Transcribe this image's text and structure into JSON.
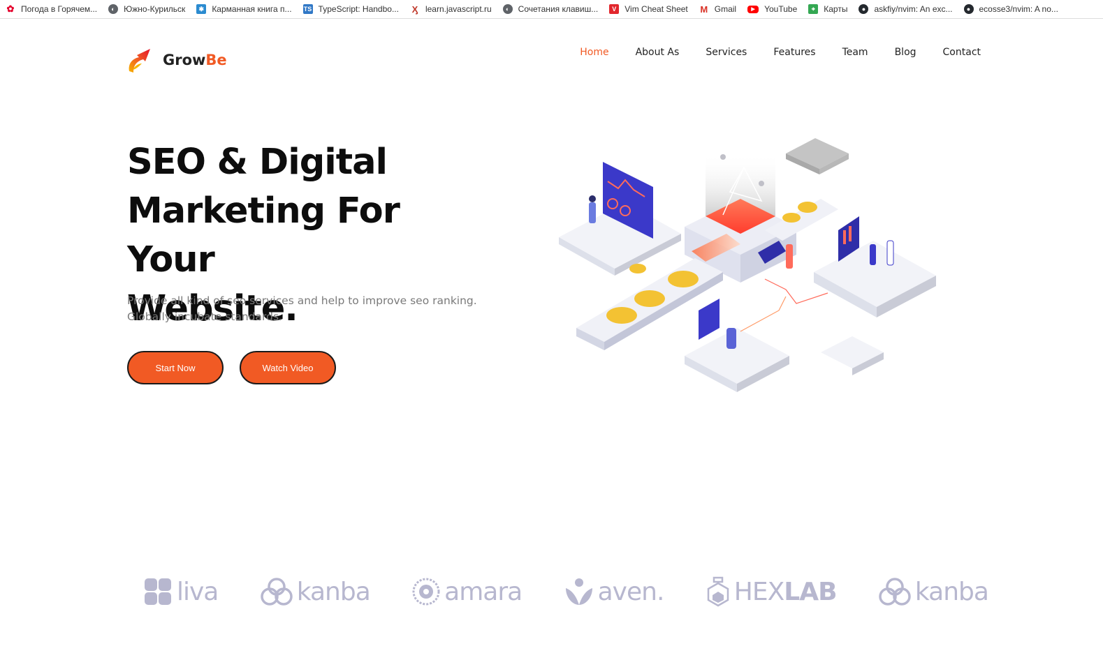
{
  "bookmarks": [
    {
      "label": "Погода в Горячем...",
      "icon": "huawei-icon",
      "color": "#e4002b"
    },
    {
      "label": "Южно-Курильск",
      "icon": "globe-icon",
      "color": "#5f6368"
    },
    {
      "label": "Карманная книга п...",
      "icon": "gear-icon",
      "color": "#2b8bd0"
    },
    {
      "label": "TypeScript: Handbo...",
      "icon": "typescript-icon",
      "color": "#3178c6"
    },
    {
      "label": "learn.javascript.ru",
      "icon": "figure-icon",
      "color": "#c0392b"
    },
    {
      "label": "Сочетания клавиш...",
      "icon": "globe-icon",
      "color": "#5f6368"
    },
    {
      "label": "Vim Cheat Sheet",
      "icon": "vim-icon",
      "color": "#e2272d"
    },
    {
      "label": "Gmail",
      "icon": "gmail-icon",
      "color": "#d93025"
    },
    {
      "label": "YouTube",
      "icon": "youtube-icon",
      "color": "#ff0000"
    },
    {
      "label": "Карты",
      "icon": "maps-icon",
      "color": "#34a853"
    },
    {
      "label": "askfiy/nvim: An exc...",
      "icon": "github-icon",
      "color": "#24292e"
    },
    {
      "label": "ecosse3/nvim: A no...",
      "icon": "github-icon",
      "color": "#24292e"
    }
  ],
  "brand": {
    "name_main": "Grow",
    "name_accent": "Be",
    "accent_color": "#f15a24"
  },
  "nav": [
    {
      "label": "Home",
      "active": true
    },
    {
      "label": "About As",
      "active": false
    },
    {
      "label": "Services",
      "active": false
    },
    {
      "label": "Features",
      "active": false
    },
    {
      "label": "Team",
      "active": false
    },
    {
      "label": "Blog",
      "active": false
    },
    {
      "label": "Contact",
      "active": false
    }
  ],
  "hero": {
    "title_line1": "SEO & Digital",
    "title_line2": "Marketing For Your",
    "title_line3": "Website.",
    "subtitle_line1": "Provide all kind of seo services and help to improve seo ranking.",
    "subtitle_line2": "Globally incubate standards.",
    "start_button": "Start Now",
    "video_button": "Watch Video"
  },
  "partners": [
    {
      "name": "liva",
      "icon": "liva-logo-icon"
    },
    {
      "name": "kanba",
      "icon": "kanba-logo-icon"
    },
    {
      "name": "amara",
      "icon": "amara-logo-icon"
    },
    {
      "name": "aven.",
      "icon": "aven-logo-icon"
    },
    {
      "name_light": "HEX",
      "name_bold": "LAB",
      "icon": "hexlab-logo-icon"
    },
    {
      "name": "kanba",
      "icon": "kanba-logo-icon"
    }
  ]
}
